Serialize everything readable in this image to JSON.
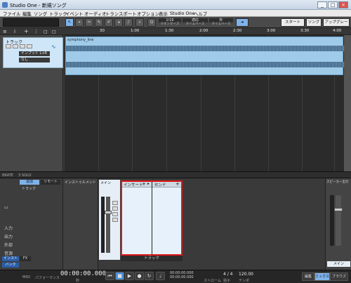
{
  "window": {
    "title": "Studio One - 新規ソング",
    "minimize": "_",
    "maximize": "□",
    "close": "×"
  },
  "menu": [
    "ファイル",
    "編集",
    "ソング",
    "トラック",
    "イベント",
    "オーディオ",
    "トランスポート",
    "オプション",
    "表示",
    "Studio One",
    "ヘルプ"
  ],
  "toolbar": {
    "quantize_value": "1/16",
    "quantize_label": "クオンタイズ",
    "snap_value": "適応",
    "snap_label": "タイムベース",
    "timebase_value": "秒",
    "timebase_label": "タイムベース",
    "start_label": "スタート",
    "song_label": "ソング",
    "upgrade_label": "アップグレード"
  },
  "ruler": {
    "ticks": [
      "30",
      "1:00",
      "1:30",
      "2:00",
      "2:30",
      "3:00",
      "3:30",
      "4:00"
    ]
  },
  "track": {
    "name": "トラック",
    "input": "インプット L+R",
    "output": "なし",
    "clip_name": "symphony_line"
  },
  "status": {
    "left1": "BRATE",
    "left2": "3 SOLO"
  },
  "browser": {
    "tab1": "追加",
    "tab2": "リモート",
    "item": "トラック",
    "labels": [
      "入力",
      "出力",
      "外部",
      "音源"
    ],
    "bottom_tabs": [
      "インスト",
      "FX"
    ],
    "bottom_label": "バンク"
  },
  "instrument": {
    "title": "インストゥルメント"
  },
  "channel": {
    "label": "メイン",
    "name": "トラック"
  },
  "fx": {
    "insert_label": "インサート",
    "send_label": "センド",
    "plus": "+",
    "arrow": "▸",
    "footer": "トラック"
  },
  "master": {
    "title": "スピーカー出力",
    "label": "メイン"
  },
  "transport": {
    "time": "00:00:00.000",
    "time_sub": "秒",
    "midi_label": "MIDI",
    "perf_label": "パフォーマンス",
    "loop_start": "00:00:00.000",
    "loop_end": "00:00:00.000",
    "loop_start_label": "ストローム",
    "signature": "4 / 4",
    "signature_label": "拍子",
    "tempo": "120.00",
    "tempo_label": "テンポ",
    "edit_label": "編集",
    "mix_label": "ミックス",
    "browse_label": "ブラウズ"
  }
}
